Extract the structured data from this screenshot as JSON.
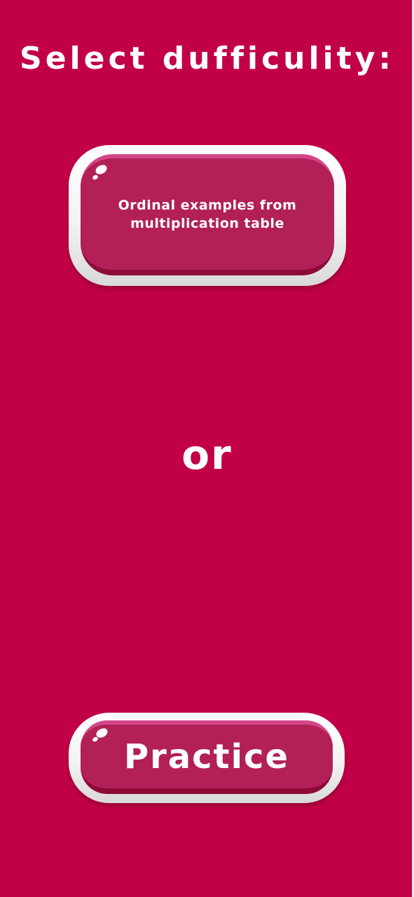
{
  "screen": {
    "title": "Select dufficulity:",
    "separator": "or",
    "background_color": "#c20047"
  },
  "buttons": {
    "ordinal_examples": {
      "label": "Ordinal examples from multiplication table"
    },
    "practice": {
      "label": "Practice"
    }
  },
  "colors": {
    "button_face": "#b22057",
    "button_rim": "#f3f3f3",
    "text": "#ffffff"
  }
}
